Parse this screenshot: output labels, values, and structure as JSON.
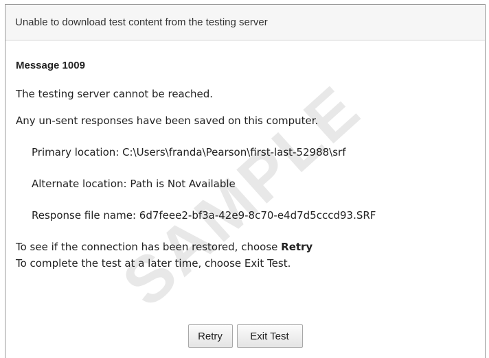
{
  "dialog": {
    "title": "Unable to download test content from the testing server",
    "message_heading": "Message 1009",
    "lines": {
      "server_unreachable": "The testing server cannot be reached.",
      "responses_saved": "Any un-sent responses have been saved on this computer.",
      "primary_location": "Primary location: C:\\Users\\franda\\Pearson\\first-last-52988\\srf",
      "alternate_location": "Alternate location: Path is Not Available",
      "response_file_name": "Response file name: 6d7feee2-bf3a-42e9-8c70-e4d7d5cccd93.SRF",
      "retry_instruction_prefix": "To see if the connection has been restored, choose ",
      "retry_instruction_emphasis": "Retry",
      "exit_instruction": "To complete the test at a later time, choose Exit Test."
    },
    "buttons": {
      "retry_label": "Retry",
      "exit_label": "Exit Test"
    },
    "watermark": "SAMPLE"
  }
}
